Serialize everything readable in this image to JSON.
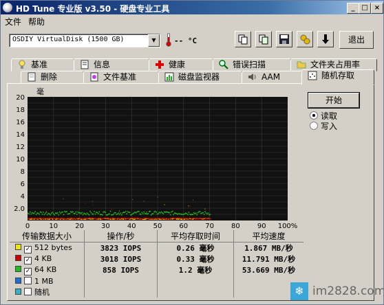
{
  "window": {
    "title": "HD Tune 专业版 v3.50 - 硬盘专业工具"
  },
  "menu": {
    "items": [
      "文件",
      "帮助"
    ]
  },
  "toolbar": {
    "drive": "OSDIY VirtualDisk (1500 GB)",
    "temperature": "-- °C",
    "exit_label": "退出"
  },
  "tabs": {
    "row1": [
      "基准",
      "信息",
      "健康",
      "错误扫描",
      "文件夹占用率"
    ],
    "row2": [
      "删除",
      "文件基准",
      "磁盘监视器",
      "AAM",
      "随机存取"
    ],
    "active": "随机存取"
  },
  "controls": {
    "start_label": "开始",
    "read_label": "读取",
    "write_label": "写入",
    "selected": "读取"
  },
  "chart_data": {
    "type": "scatter",
    "y_unit_label": "毫",
    "ylim": [
      0,
      20
    ],
    "y_ticks": [
      "20",
      "18",
      "16",
      "14",
      "12",
      "10",
      "8",
      "6",
      "4",
      "2.0"
    ],
    "x_ticks": [
      "0",
      "10",
      "20",
      "30",
      "40",
      "50",
      "60",
      "70",
      "80",
      "90",
      "100%"
    ],
    "xlim": [
      0,
      100
    ],
    "grid": true,
    "series": [
      {
        "name": "512 bytes",
        "color": "#e8e800",
        "x_range": [
          0,
          70
        ],
        "y_approx": 0.26
      },
      {
        "name": "4 KB",
        "color": "#cc0000",
        "x_range": [
          0,
          70
        ],
        "y_approx": 0.33
      },
      {
        "name": "64 KB",
        "color": "#22bb22",
        "x_range": [
          0,
          70
        ],
        "y_approx": 1.2
      }
    ]
  },
  "results": {
    "headers": [
      "传输数据大小",
      "操作/秒",
      "平均存取时间",
      "平均速度"
    ],
    "rows": [
      {
        "color": "#e8e800",
        "checked": true,
        "size": "512 bytes",
        "ops": "3823 IOPS",
        "access": "0.26 毫秒",
        "speed": "1.867 MB/秒"
      },
      {
        "color": "#cc0000",
        "checked": true,
        "size": "4 KB",
        "ops": "3018 IOPS",
        "access": "0.33 毫秒",
        "speed": "11.791 MB/秒"
      },
      {
        "color": "#22bb22",
        "checked": true,
        "size": "64 KB",
        "ops": "858 IOPS",
        "access": "1.2 毫秒",
        "speed": "53.669 MB/秒"
      },
      {
        "color": "#1e6ed8",
        "checked": false,
        "size": "1 MB",
        "ops": "",
        "access": "",
        "speed": ""
      },
      {
        "color": "#3ab0c8",
        "checked": false,
        "size": "随机",
        "ops": "",
        "access": "",
        "speed": ""
      }
    ]
  },
  "watermark": {
    "text": "im2828.com"
  }
}
